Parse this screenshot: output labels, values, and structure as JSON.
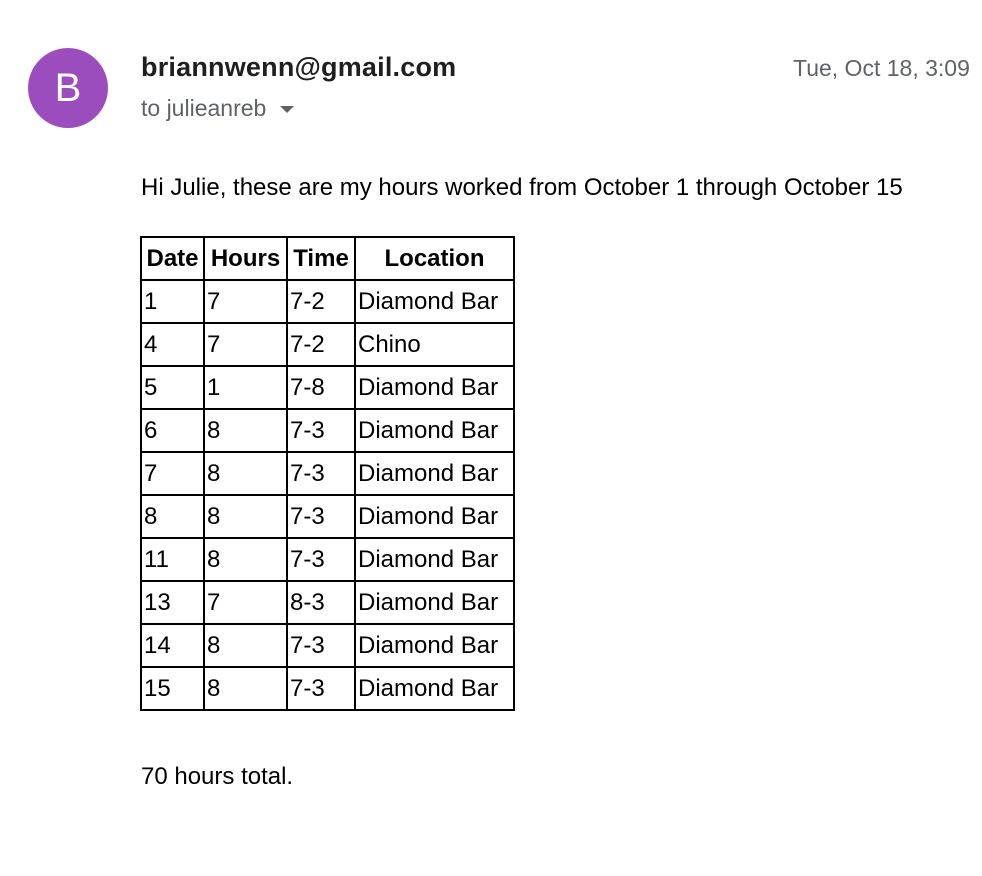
{
  "sender": {
    "avatar_letter": "B",
    "avatar_color": "#9c4dbd",
    "email": "briannwenn@gmail.com"
  },
  "recipient": {
    "text": "to julieanreb"
  },
  "timestamp": "Tue, Oct 18, 3:09 ",
  "body": {
    "intro": "Hi Julie, these are my hours worked from October 1 through October 15",
    "table": {
      "headers": [
        "Date",
        "Hours",
        "Time",
        "Location"
      ],
      "rows": [
        [
          "1",
          "7",
          "7-2",
          "Diamond Bar"
        ],
        [
          "4",
          "7",
          "7-2",
          "Chino"
        ],
        [
          "5",
          "1",
          "7-8",
          "Diamond Bar"
        ],
        [
          "6",
          "8",
          "7-3",
          "Diamond Bar"
        ],
        [
          "7",
          "8",
          "7-3",
          "Diamond Bar"
        ],
        [
          "8",
          "8",
          "7-3",
          "Diamond Bar"
        ],
        [
          "11",
          "8",
          "7-3",
          "Diamond Bar"
        ],
        [
          "13",
          "7",
          "8-3",
          "Diamond Bar"
        ],
        [
          "14",
          "8",
          "7-3",
          "Diamond Bar"
        ],
        [
          "15",
          "8",
          "7-3",
          "Diamond Bar"
        ]
      ]
    },
    "total": "70 hours total."
  }
}
